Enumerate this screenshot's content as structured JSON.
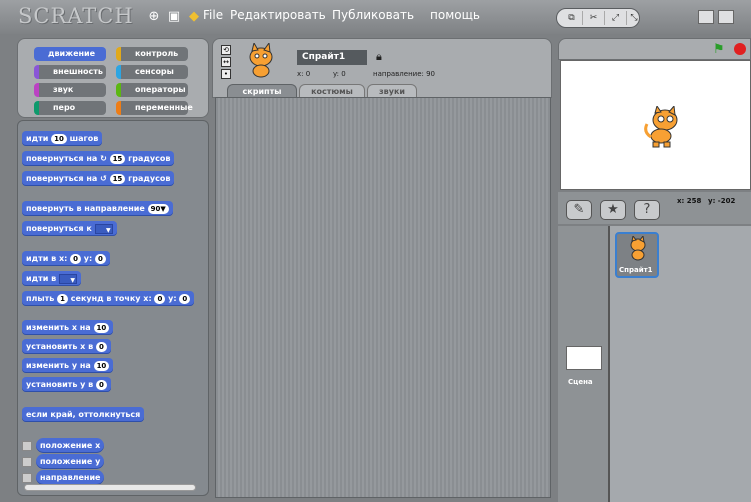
{
  "topbar": {
    "logo": "SCRATCH",
    "menu": [
      "File",
      "Редактировать",
      "Публиковать",
      "помощь"
    ]
  },
  "categories": [
    {
      "label": "движение",
      "color": "#4a6cd4"
    },
    {
      "label": "контроль",
      "color": "#e1a91a"
    },
    {
      "label": "внешность",
      "color": "#8a55d7"
    },
    {
      "label": "сенсоры",
      "color": "#2ca5e2"
    },
    {
      "label": "звук",
      "color": "#bb42c3"
    },
    {
      "label": "операторы",
      "color": "#5cb712"
    },
    {
      "label": "перо",
      "color": "#0e9a6c"
    },
    {
      "label": "переменные",
      "color": "#ee7d16"
    }
  ],
  "blocks": {
    "move_a": "идти",
    "move_n": "10",
    "move_b": "шагов",
    "turn_r_a": "повернуться на",
    "turn_r_n": "15",
    "turn_r_b": "градусов",
    "turn_l_a": "повернуться на",
    "turn_l_n": "15",
    "turn_l_b": "градусов",
    "point_dir_a": "повернуть в направление",
    "point_dir_n": "90▼",
    "point_to": "повернуться к",
    "goto_xy_a": "идти в x:",
    "goto_xy_x": "0",
    "goto_xy_b": "y:",
    "goto_xy_y": "0",
    "goto": "идти в",
    "glide_a": "плыть",
    "glide_s": "1",
    "glide_b": "секунд в точку x:",
    "glide_x": "0",
    "glide_c": "y:",
    "glide_y": "0",
    "chx_a": "изменить х на",
    "chx_n": "10",
    "setx_a": "установить х в",
    "setx_n": "0",
    "chy_a": "изменить у на",
    "chy_n": "10",
    "sety_a": "установить у в",
    "sety_n": "0",
    "bounce": "если край, оттолкнуться",
    "rep_x": "положение x",
    "rep_y": "положение y",
    "rep_dir": "направление"
  },
  "sprite": {
    "name": "Спрайт1",
    "x_label": "x: 0",
    "y_label": "y: 0",
    "dir_label": "направление: 90"
  },
  "tabs": [
    "скрипты",
    "костюмы",
    "звуки"
  ],
  "stage": {
    "coords_x": "x: 258",
    "coords_y": "y: -202"
  },
  "sprites_list": {
    "sprite1": "Спрайт1",
    "stage_label": "Сцена"
  }
}
